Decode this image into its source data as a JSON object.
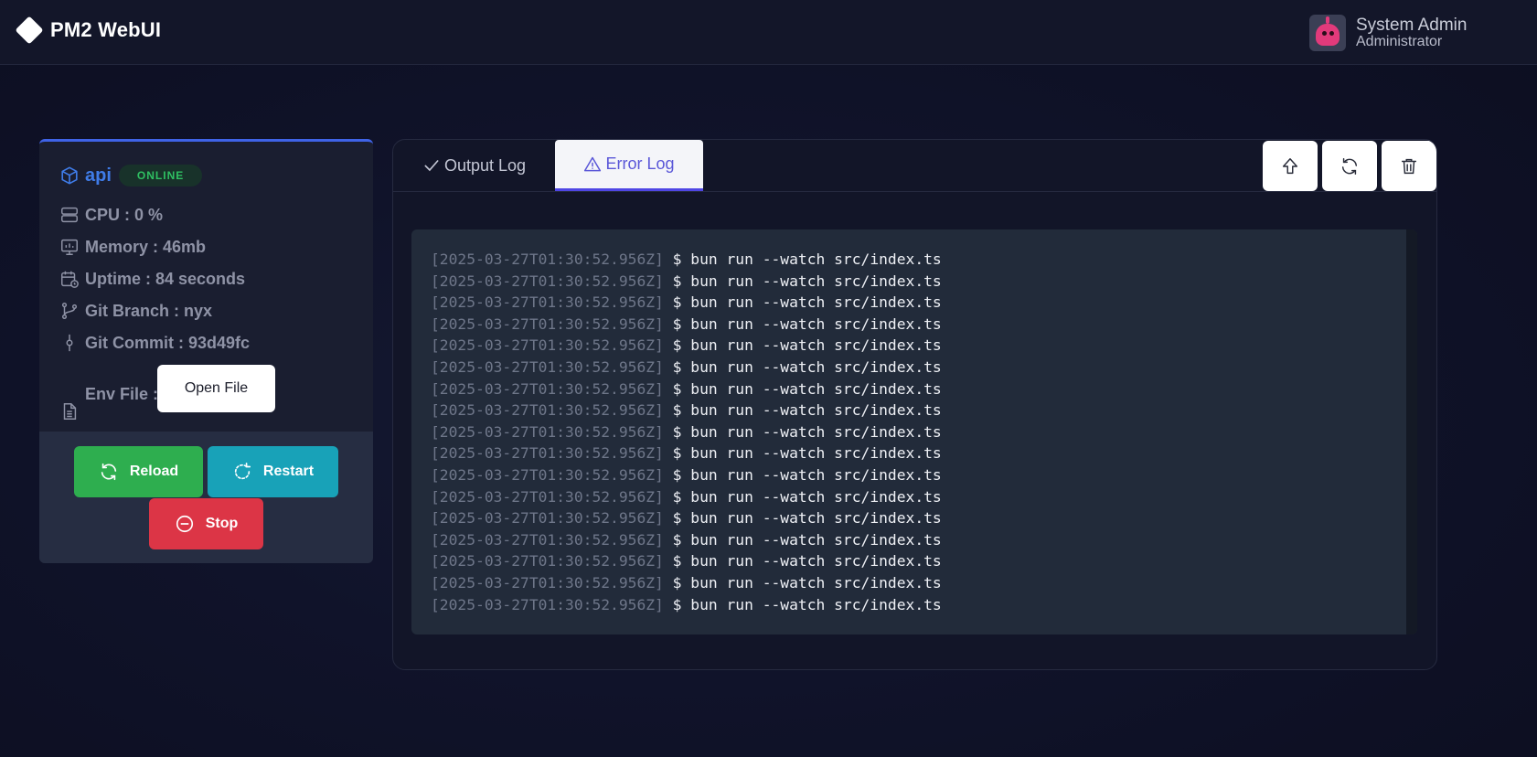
{
  "app": {
    "title": "PM2 WebUI"
  },
  "user": {
    "name": "System Admin",
    "role": "Administrator"
  },
  "process": {
    "name": "api",
    "status": "ONLINE",
    "stats": {
      "cpu": "CPU : 0 %",
      "memory": "Memory : 46mb",
      "uptime": "Uptime : 84 seconds",
      "git_branch": "Git Branch : nyx",
      "git_commit": "Git Commit : 93d49fc",
      "env_file": "Env File :"
    },
    "open_file_label": "Open File",
    "actions": {
      "reload": "Reload",
      "restart": "Restart",
      "stop": "Stop"
    }
  },
  "logs": {
    "tabs": [
      {
        "label": "Output Log",
        "icon": "check-icon",
        "active": false
      },
      {
        "label": "Error Log",
        "icon": "warning-icon",
        "active": true
      }
    ],
    "toolbar": [
      "arrow-up-icon",
      "refresh-icon",
      "trash-icon"
    ],
    "lines": [
      {
        "ts": "[2025-03-27T01:30:52.956Z]",
        "cmd": "$ bun run --watch src/index.ts"
      },
      {
        "ts": "[2025-03-27T01:30:52.956Z]",
        "cmd": "$ bun run --watch src/index.ts"
      },
      {
        "ts": "[2025-03-27T01:30:52.956Z]",
        "cmd": "$ bun run --watch src/index.ts"
      },
      {
        "ts": "[2025-03-27T01:30:52.956Z]",
        "cmd": "$ bun run --watch src/index.ts"
      },
      {
        "ts": "[2025-03-27T01:30:52.956Z]",
        "cmd": "$ bun run --watch src/index.ts"
      },
      {
        "ts": "[2025-03-27T01:30:52.956Z]",
        "cmd": "$ bun run --watch src/index.ts"
      },
      {
        "ts": "[2025-03-27T01:30:52.956Z]",
        "cmd": "$ bun run --watch src/index.ts"
      },
      {
        "ts": "[2025-03-27T01:30:52.956Z]",
        "cmd": "$ bun run --watch src/index.ts"
      },
      {
        "ts": "[2025-03-27T01:30:52.956Z]",
        "cmd": "$ bun run --watch src/index.ts"
      },
      {
        "ts": "[2025-03-27T01:30:52.956Z]",
        "cmd": "$ bun run --watch src/index.ts"
      },
      {
        "ts": "[2025-03-27T01:30:52.956Z]",
        "cmd": "$ bun run --watch src/index.ts"
      },
      {
        "ts": "[2025-03-27T01:30:52.956Z]",
        "cmd": "$ bun run --watch src/index.ts"
      },
      {
        "ts": "[2025-03-27T01:30:52.956Z]",
        "cmd": "$ bun run --watch src/index.ts"
      },
      {
        "ts": "[2025-03-27T01:30:52.956Z]",
        "cmd": "$ bun run --watch src/index.ts"
      },
      {
        "ts": "[2025-03-27T01:30:52.956Z]",
        "cmd": "$ bun run --watch src/index.ts"
      },
      {
        "ts": "[2025-03-27T01:30:52.956Z]",
        "cmd": "$ bun run --watch src/index.ts"
      },
      {
        "ts": "[2025-03-27T01:30:52.956Z]",
        "cmd": "$ bun run --watch src/index.ts"
      }
    ]
  },
  "colors": {
    "accent": "#3f63e6",
    "online": "#2fbf62",
    "reload": "#2eae4f",
    "restart": "#18a2b8",
    "stop": "#dc3546",
    "tab_active": "#5a57d8"
  }
}
